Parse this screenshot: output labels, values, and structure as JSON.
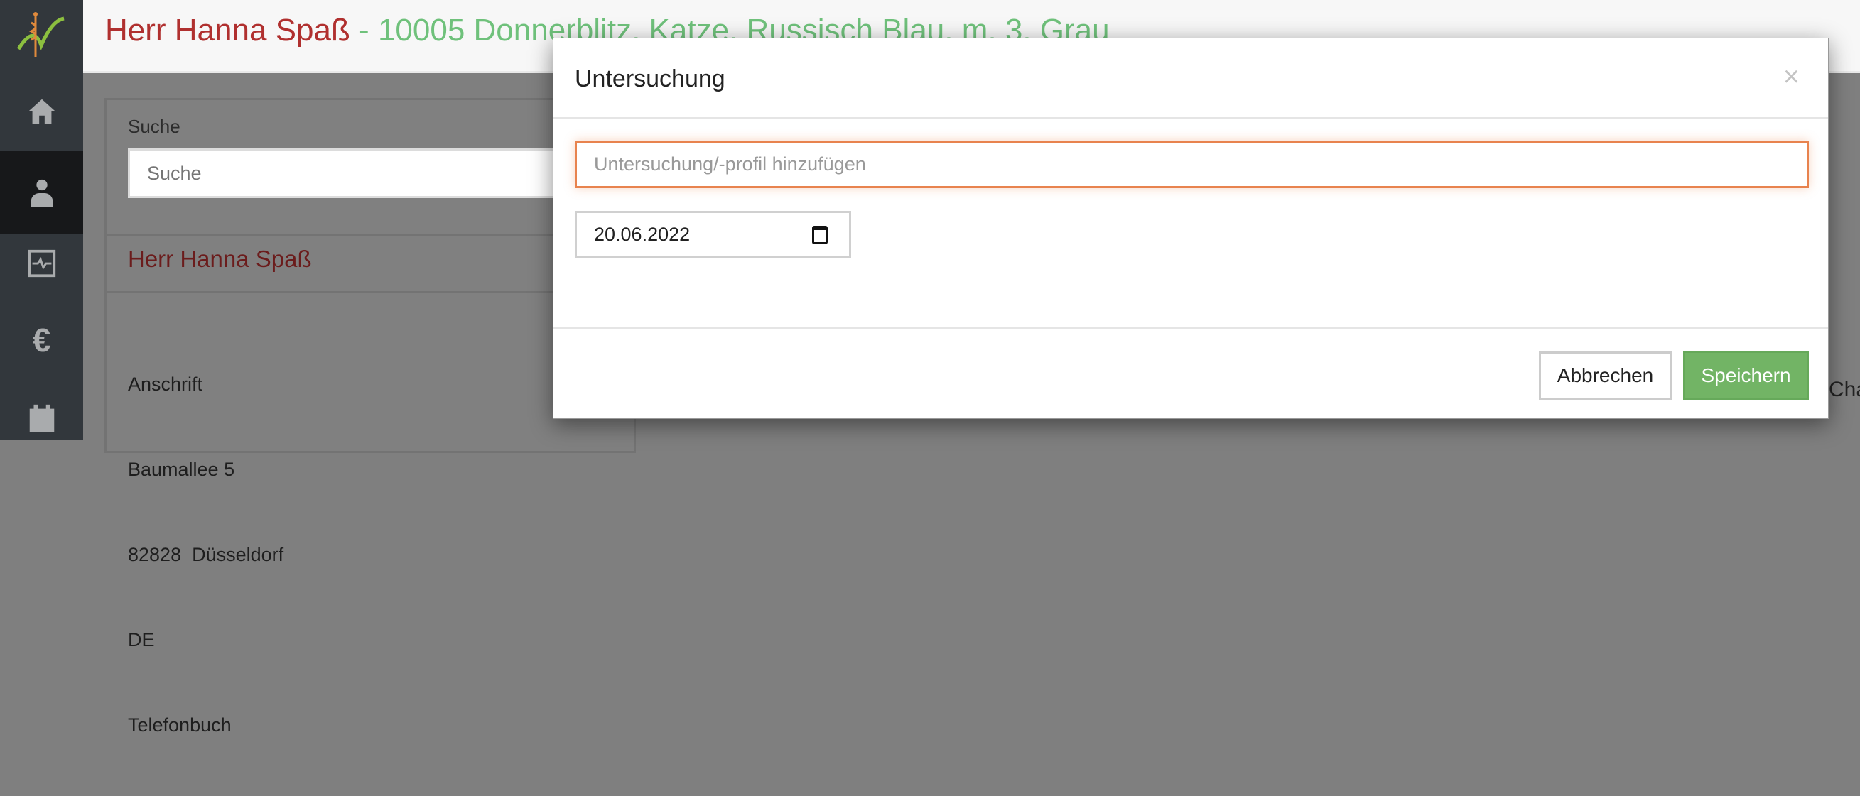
{
  "header": {
    "name": "Herr Hanna Spaß",
    "separator": " - ",
    "patient": "10005 Donnerblitz, Katze, Russisch Blau, m, 3, Grau"
  },
  "sidebar": {
    "items": [
      {
        "icon": "home-icon"
      },
      {
        "icon": "doctor-icon",
        "active": true
      },
      {
        "icon": "monitor-icon"
      },
      {
        "icon": "euro-icon"
      },
      {
        "icon": "calendar-icon"
      }
    ]
  },
  "panel": {
    "search_label": "Suche",
    "search_placeholder": "Suche",
    "patient_name": "Herr Hanna Spaß",
    "address": [
      "Anschrift",
      "Baumallee 5",
      "82828  Düsseldorf",
      "DE",
      "Telefonbuch"
    ]
  },
  "right_partial": "Cha",
  "modal": {
    "title": "Untersuchung",
    "close": "×",
    "exam_placeholder": "Untersuchung/-profil hinzufügen",
    "date": "20.06.2022",
    "cancel": "Abbrechen",
    "save": "Speichern"
  },
  "colors": {
    "accent_red": "#b0302f",
    "accent_green": "#6fc17b",
    "save_green": "#72b465",
    "focus_orange": "#e8834e"
  }
}
